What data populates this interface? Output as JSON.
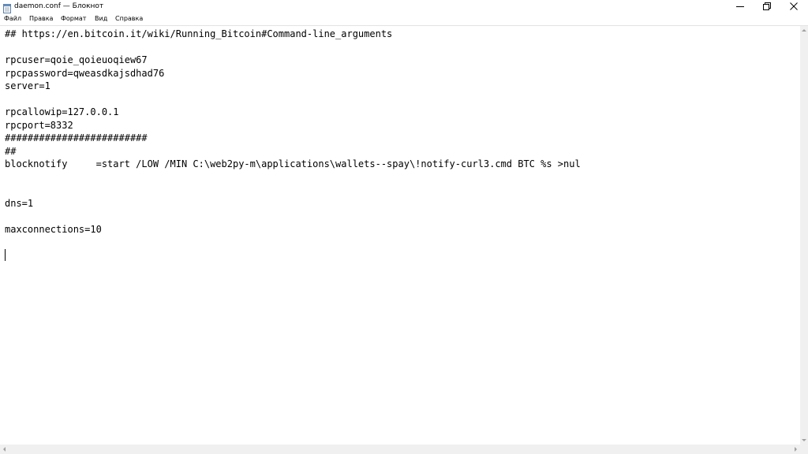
{
  "window": {
    "title": "daemon.conf — Блокнот"
  },
  "menu": {
    "items": [
      "Файл",
      "Правка",
      "Формат",
      "Вид",
      "Справка"
    ]
  },
  "editor": {
    "content": "## https://en.bitcoin.it/wiki/Running_Bitcoin#Command-line_arguments\n\nrpcuser=qoie_qoieuoqiew67\nrpcpassword=qweasdkajsdhad76\nserver=1\n\nrpcallowip=127.0.0.1\nrpcport=8332\n#########################\n##\nblocknotify     =start /LOW /MIN C:\\web2py-m\\applications\\wallets--spay\\!notify-curl3.cmd BTC %s >nul\n\n\ndns=1\n\nmaxconnections=10\n\n"
  },
  "icons": {
    "app": "notepad-icon",
    "minimize": "minimize-icon",
    "maximize": "restore-icon",
    "close": "close-icon"
  },
  "colors": {
    "background": "#ffffff",
    "text": "#000000",
    "scrollbar": "#f0f0f0"
  }
}
